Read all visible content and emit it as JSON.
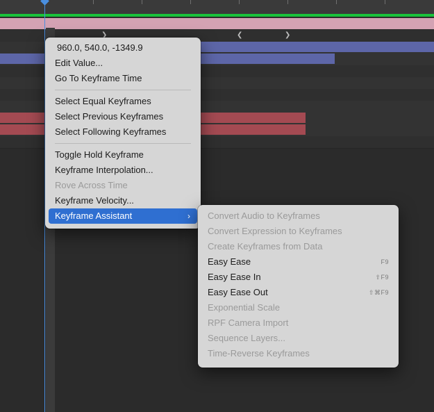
{
  "colors": {
    "playhead": "#4a8fe0",
    "work_area": "#19c33a",
    "layer_pink": "#d4a2b3",
    "layer_blue": "#5d66a8",
    "layer_red": "#a44a52",
    "menu_bg": "#d6d6d6",
    "menu_highlight": "#2f6fd1"
  },
  "timeline": {
    "keyframe_icons": [
      "keyframe-right-icon",
      "keyframe-left-icon",
      "keyframe-right-icon"
    ]
  },
  "context_menu": {
    "value_header": "960.0, 540.0, -1349.9",
    "edit_value": "Edit Value...",
    "go_to_time": "Go To Keyframe Time",
    "select_equal": "Select Equal Keyframes",
    "select_previous": "Select Previous Keyframes",
    "select_following": "Select Following Keyframes",
    "toggle_hold": "Toggle Hold Keyframe",
    "interpolation": "Keyframe Interpolation...",
    "rove": "Rove Across Time",
    "velocity": "Keyframe Velocity...",
    "assistant": "Keyframe Assistant",
    "assistant_chevron": "›"
  },
  "submenu": {
    "convert_audio": "Convert Audio to Keyframes",
    "convert_expression": "Convert Expression to Keyframes",
    "create_from_data": "Create Keyframes from Data",
    "easy_ease": "Easy Ease",
    "easy_ease_shortcut": "F9",
    "easy_ease_in": "Easy Ease In",
    "easy_ease_in_shortcut": "⇧F9",
    "easy_ease_out": "Easy Ease Out",
    "easy_ease_out_shortcut": "⇧⌘F9",
    "exponential_scale": "Exponential Scale",
    "rpf_camera": "RPF Camera Import",
    "sequence_layers": "Sequence Layers...",
    "time_reverse": "Time-Reverse Keyframes"
  }
}
